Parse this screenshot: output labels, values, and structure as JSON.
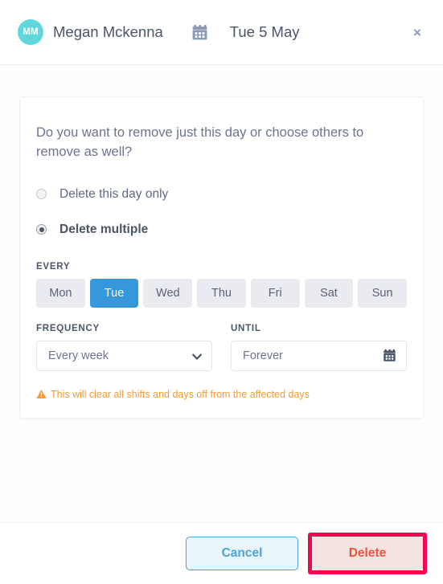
{
  "header": {
    "avatar_initials": "MM",
    "employee_name": "Megan Mckenna",
    "calendar_icon": "calendar-icon",
    "date": "Tue 5 May",
    "close_icon": "×"
  },
  "card": {
    "prompt": "Do you want to remove just this day or choose others to remove as well?",
    "options": [
      {
        "label": "Delete this day only",
        "selected": false
      },
      {
        "label": "Delete multiple",
        "selected": true
      }
    ],
    "every": {
      "label": "EVERY",
      "days": [
        {
          "label": "Mon",
          "selected": false
        },
        {
          "label": "Tue",
          "selected": true
        },
        {
          "label": "Wed",
          "selected": false
        },
        {
          "label": "Thu",
          "selected": false
        },
        {
          "label": "Fri",
          "selected": false
        },
        {
          "label": "Sat",
          "selected": false
        },
        {
          "label": "Sun",
          "selected": false
        }
      ]
    },
    "frequency": {
      "label": "FREQUENCY",
      "value": "Every week",
      "icon": "chevron-down-icon"
    },
    "until": {
      "label": "UNTIL",
      "value": "Forever",
      "icon": "calendar-icon"
    },
    "warning": {
      "icon": "warning-triangle-icon",
      "text": "This will clear all shifts and days off from the affected days"
    }
  },
  "footer": {
    "cancel_label": "Cancel",
    "delete_label": "Delete"
  },
  "colors": {
    "avatar": "#5fd7dc",
    "day_selected": "#3498db",
    "warning": "#f29a3a",
    "cancel_accent": "#4aa3df",
    "delete_text": "#e8543f",
    "highlight": "#f5054f"
  }
}
